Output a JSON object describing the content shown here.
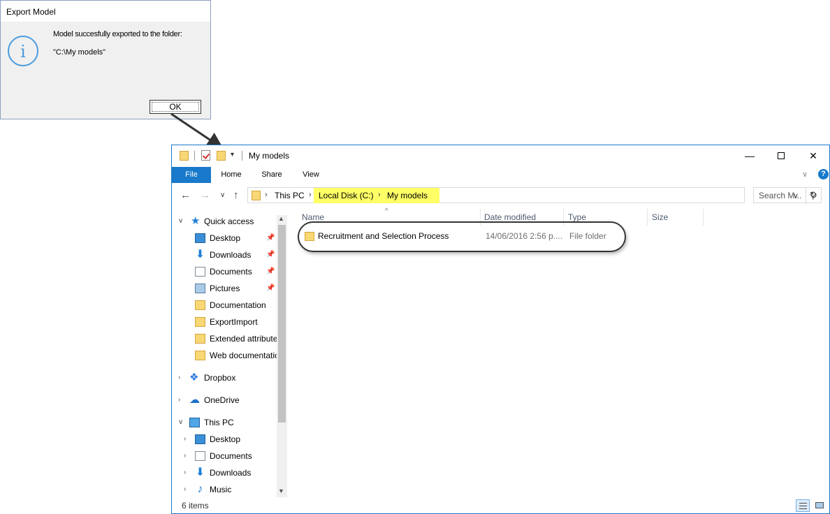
{
  "dialog": {
    "title": "Export Model",
    "icon": "info-icon",
    "message": "Model succesfully exported to the folder:",
    "path": "\"C:\\My models\"",
    "ok_label": "OK"
  },
  "explorer": {
    "window_title": "My models",
    "ribbon_tabs": [
      "File",
      "Home",
      "Share",
      "View"
    ],
    "breadcrumb": [
      "This PC",
      "Local Disk (C:)",
      "My models"
    ],
    "search_placeholder": "Search M...",
    "columns": [
      "Name",
      "Date modified",
      "Type",
      "Size"
    ],
    "files": [
      {
        "name": "Recruitment and Selection Process",
        "date_modified": "14/06/2016 2:56 p....",
        "type": "File folder",
        "size": ""
      }
    ],
    "nav_pane": {
      "quick_access_label": "Quick access",
      "quick_access": [
        "Desktop",
        "Downloads",
        "Documents",
        "Pictures",
        "Documentation",
        "ExportImport",
        "Extended attribute",
        "Web documentatio"
      ],
      "dropbox_label": "Dropbox",
      "onedrive_label": "OneDrive",
      "this_pc_label": "This PC",
      "this_pc": [
        "Desktop",
        "Documents",
        "Downloads",
        "Music"
      ]
    },
    "status": "6 items",
    "colors": {
      "accent": "#1979ca",
      "highlight": "#ffff66",
      "folder": "#f8d775"
    }
  }
}
